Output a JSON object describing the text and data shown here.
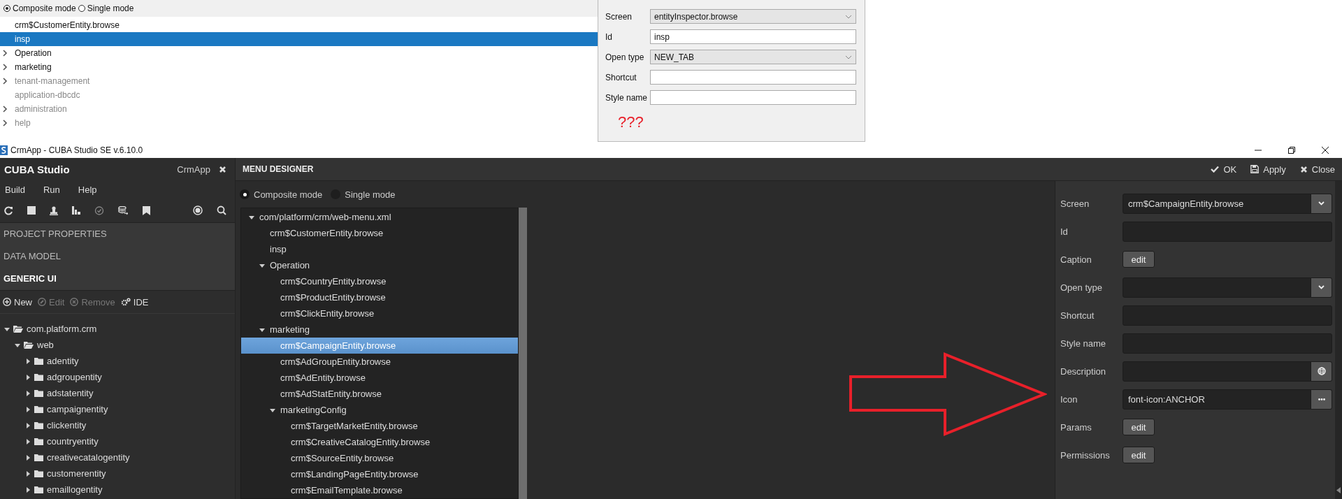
{
  "top_panel": {
    "modes": [
      {
        "label": "Composite mode",
        "selected": true
      },
      {
        "label": "Single mode",
        "selected": false
      }
    ],
    "items": [
      {
        "label": "crm$CustomerEntity.browse",
        "selected": false,
        "disabled": false
      },
      {
        "label": "insp",
        "selected": true,
        "disabled": false
      },
      {
        "label": "Operation",
        "selected": false,
        "disabled": false,
        "expanded": false
      },
      {
        "label": "marketing",
        "selected": false,
        "disabled": false,
        "expanded": false
      },
      {
        "label": "tenant-management",
        "selected": false,
        "disabled": true,
        "expanded": false
      },
      {
        "label": "application-dbcdc",
        "selected": false,
        "disabled": true
      },
      {
        "label": "administration",
        "selected": false,
        "disabled": true,
        "expanded": false
      },
      {
        "label": "help",
        "selected": false,
        "disabled": true,
        "expanded": false
      }
    ]
  },
  "top_form": {
    "fields": [
      {
        "label": "Screen",
        "kind": "select",
        "value": "entityInspector.browse"
      },
      {
        "label": "Id",
        "kind": "text",
        "value": "insp"
      },
      {
        "label": "Open type",
        "kind": "select",
        "value": "NEW_TAB"
      },
      {
        "label": "Shortcut",
        "kind": "text"
      },
      {
        "label": "Style name",
        "kind": "text"
      }
    ],
    "note": "???"
  },
  "window": {
    "title": "CrmApp - CUBA Studio SE v.6.10.0"
  },
  "sidebar": {
    "brand": "CUBA Studio",
    "project": "CrmApp",
    "menu": [
      "Build",
      "Run",
      "Help"
    ],
    "sections": [
      {
        "label": "PROJECT PROPERTIES",
        "selected": false
      },
      {
        "label": "DATA MODEL",
        "selected": false
      },
      {
        "label": "GENERIC UI",
        "selected": true
      }
    ],
    "actions": [
      {
        "label": "New",
        "kind": "new",
        "disabled": false
      },
      {
        "label": "Edit",
        "kind": "edit",
        "disabled": true
      },
      {
        "label": "Remove",
        "kind": "remove",
        "disabled": true
      },
      {
        "label": "IDE",
        "kind": "ide",
        "disabled": false
      }
    ],
    "tree": [
      {
        "label": "com.platform.crm",
        "expanded": true,
        "children": [
          {
            "label": "web",
            "expanded": true,
            "children": [
              {
                "label": "adentity",
                "expanded": false
              },
              {
                "label": "adgroupentity",
                "expanded": false
              },
              {
                "label": "adstatentity",
                "expanded": false
              },
              {
                "label": "campaignentity",
                "expanded": false
              },
              {
                "label": "clickentity",
                "expanded": false
              },
              {
                "label": "countryentity",
                "expanded": false
              },
              {
                "label": "creativecatalogentity",
                "expanded": false
              },
              {
                "label": "customerentity",
                "expanded": false
              },
              {
                "label": "emaillogentity",
                "expanded": false
              }
            ]
          }
        ]
      }
    ]
  },
  "designer": {
    "title": "MENU DESIGNER",
    "actions": [
      {
        "label": "OK",
        "kind": "ok"
      },
      {
        "label": "Apply",
        "kind": "apply"
      },
      {
        "label": "Close",
        "kind": "close"
      }
    ],
    "modes": [
      {
        "label": "Composite mode",
        "selected": true
      },
      {
        "label": "Single mode",
        "selected": false
      }
    ],
    "tree": [
      {
        "label": "com/platform/crm/web-menu.xml",
        "expanded": true,
        "selected": false,
        "children": [
          {
            "label": "crm$CustomerEntity.browse",
            "selected": false
          },
          {
            "label": "insp",
            "selected": false
          },
          {
            "label": "Operation",
            "expanded": true,
            "selected": false,
            "children": [
              {
                "label": "crm$CountryEntity.browse",
                "selected": false
              },
              {
                "label": "crm$ProductEntity.browse",
                "selected": false
              },
              {
                "label": "crm$ClickEntity.browse",
                "selected": false
              }
            ]
          },
          {
            "label": "marketing",
            "expanded": true,
            "selected": false,
            "children": [
              {
                "label": "crm$CampaignEntity.browse",
                "selected": true
              },
              {
                "label": "crm$AdGroupEntity.browse",
                "selected": false
              },
              {
                "label": "crm$AdEntity.browse",
                "selected": false
              },
              {
                "label": "crm$AdStatEntity.browse",
                "selected": false
              },
              {
                "label": "marketingConfig",
                "expanded": true,
                "selected": false,
                "children": [
                  {
                    "label": "crm$TargetMarketEntity.browse",
                    "selected": false
                  },
                  {
                    "label": "crm$CreativeCatalogEntity.browse",
                    "selected": false
                  },
                  {
                    "label": "crm$SourceEntity.browse",
                    "selected": false
                  },
                  {
                    "label": "crm$LandingPageEntity.browse",
                    "selected": false
                  },
                  {
                    "label": "crm$EmailTemplate.browse",
                    "selected": false
                  }
                ]
              }
            ]
          }
        ]
      }
    ],
    "properties": [
      {
        "label": "Screen",
        "kind": "select",
        "value": "crm$CampaignEntity.browse"
      },
      {
        "label": "Id",
        "kind": "text"
      },
      {
        "label": "Caption",
        "kind": "button",
        "button": "edit"
      },
      {
        "label": "Open type",
        "kind": "select"
      },
      {
        "label": "Shortcut",
        "kind": "text"
      },
      {
        "label": "Style name",
        "kind": "text"
      },
      {
        "label": "Description",
        "kind": "localized"
      },
      {
        "label": "Icon",
        "kind": "picker",
        "value": "font-icon:ANCHOR"
      },
      {
        "label": "Params",
        "kind": "button",
        "button": "edit"
      },
      {
        "label": "Permissions",
        "kind": "button",
        "button": "edit"
      }
    ]
  }
}
